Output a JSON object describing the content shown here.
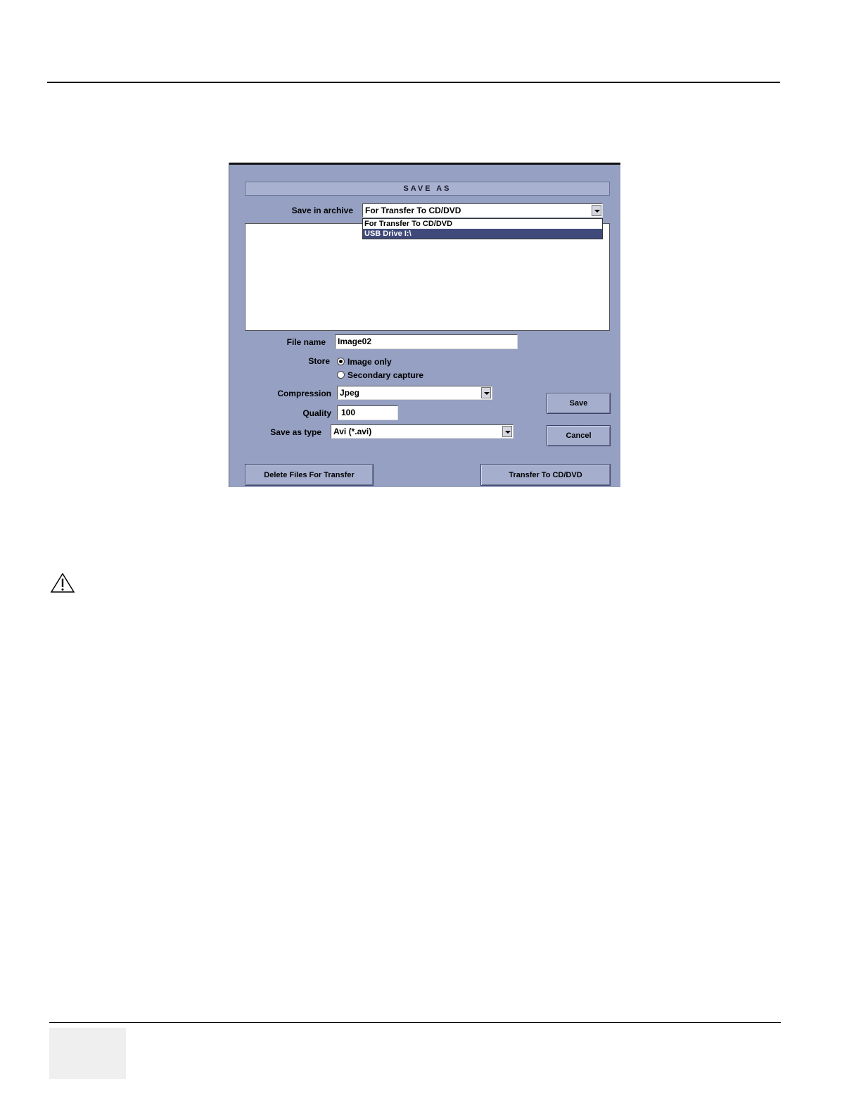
{
  "dialog": {
    "title": "SAVE AS",
    "save_in_label": "Save in archive",
    "save_in_value": "For Transfer To CD/DVD",
    "save_in_options": [
      "For Transfer To CD/DVD",
      "USB Drive   I:\\"
    ],
    "file_name_label": "File name",
    "file_name_value": "Image02",
    "store_label": "Store",
    "store_options": [
      "Image only",
      "Secondary capture"
    ],
    "store_selected": "Image only",
    "compression_label": "Compression",
    "compression_value": "Jpeg",
    "quality_label": "Quality",
    "quality_value": "100",
    "save_type_label": "Save as type",
    "save_type_value": "Avi  (*.avi)",
    "save_button": "Save",
    "cancel_button": "Cancel",
    "delete_button": "Delete Files For Transfer",
    "transfer_button": "Transfer To CD/DVD"
  },
  "icons": {
    "warning": "warning-triangle-icon"
  }
}
